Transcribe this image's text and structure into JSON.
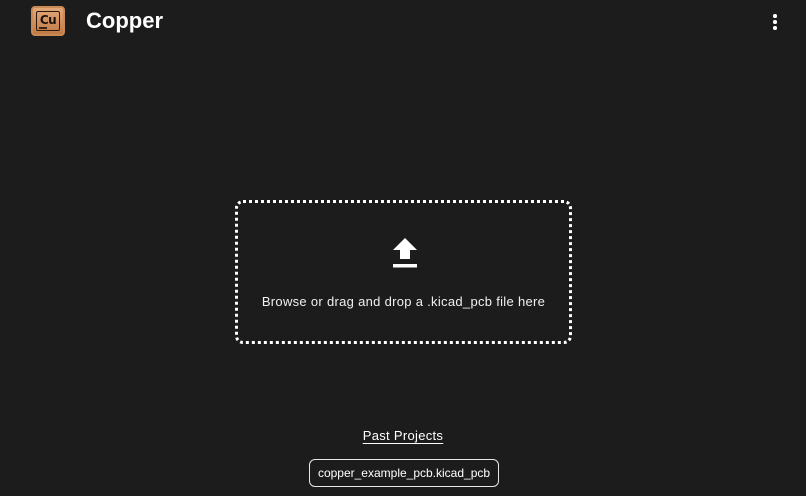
{
  "app": {
    "title": "Copper",
    "logo_text": "Cu"
  },
  "upload": {
    "prompt": "Browse or drag and drop a .kicad_pcb file here"
  },
  "past_projects": {
    "title": "Past Projects",
    "items": [
      "copper_example_pcb.kicad_pcb"
    ]
  },
  "icons": {
    "menu": "more-vert-icon",
    "upload": "upload-icon",
    "logo": "copper-logo-icon"
  }
}
